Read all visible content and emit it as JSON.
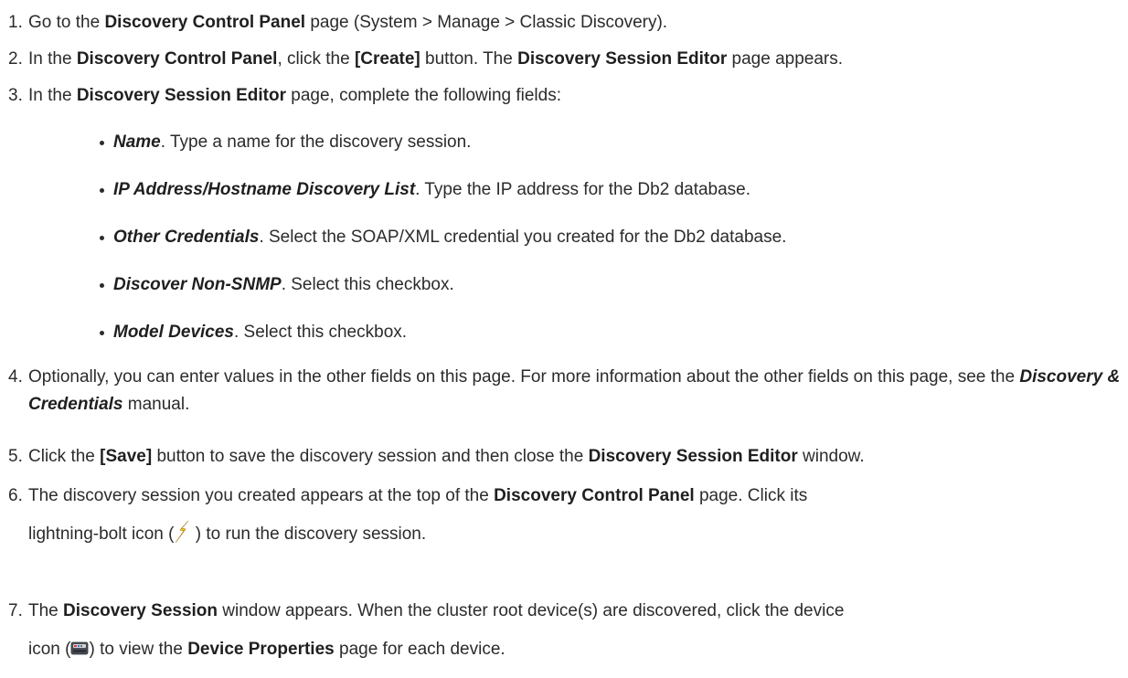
{
  "steps": [
    {
      "num": "1.",
      "parts": [
        "Go to the ",
        "Discovery Control Panel",
        " page (System > Manage > Classic Discovery)."
      ]
    },
    {
      "num": "2.",
      "parts": [
        "In the ",
        "Discovery Control Panel",
        ", click the ",
        "[Create]",
        " button. The ",
        "Discovery Session Editor",
        " page appears."
      ]
    },
    {
      "num": "3.",
      "parts": [
        "In the ",
        "Discovery Session Editor",
        " page, complete the following fields:"
      ]
    },
    {
      "num": "4.",
      "parts": [
        "Optionally, you can enter values in the other fields on this page. For more information about the other fields on this page, see the ",
        "Discovery & Credentials",
        " manual."
      ]
    },
    {
      "num": "5.",
      "parts": [
        "Click the ",
        "[Save]",
        " button to save the discovery session and then close the ",
        "Discovery Session Editor",
        " window."
      ]
    },
    {
      "num": "6.",
      "parts": [
        "The discovery session you created appears at the top of the ",
        "Discovery Control Panel",
        " page. Click its",
        "lightning-bolt icon (",
        " ) to run the discovery session."
      ]
    },
    {
      "num": "7.",
      "parts": [
        "The ",
        "Discovery Session",
        " window appears. When the cluster root device(s) are discovered, click the device",
        "icon (",
        ") to view the ",
        "Device Properties",
        " page for each device."
      ]
    }
  ],
  "fields": [
    {
      "name": "Name",
      "desc": ". Type a name for the discovery session."
    },
    {
      "name": "IP Address/Hostname Discovery List",
      "desc": ". Type the IP address for the Db2 database."
    },
    {
      "name": "Other Credentials",
      "desc": ". Select the SOAP/XML credential you created for the Db2 database."
    },
    {
      "name": "Discover Non-SNMP",
      "desc": ". Select this checkbox."
    },
    {
      "name": "Model Devices",
      "desc": ". Select this checkbox."
    }
  ],
  "icons": {
    "lightning": "lightning-bolt-icon",
    "device": "device-icon"
  }
}
